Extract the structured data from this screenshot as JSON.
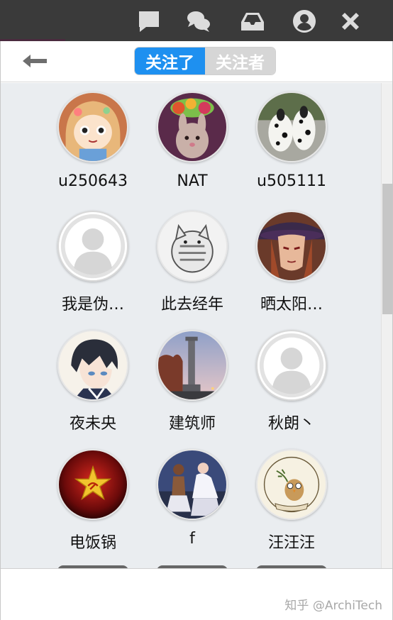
{
  "titlebar": {
    "icons": [
      "message-icon",
      "chat-bubbles-icon",
      "inbox-icon",
      "account-icon",
      "close-icon"
    ]
  },
  "navbar": {
    "back_icon": "back-arrow-icon",
    "tabs": [
      {
        "label": "关注了",
        "active": true
      },
      {
        "label": "关注者",
        "active": false
      }
    ]
  },
  "users": [
    {
      "name": "u250643",
      "avatar": "anime-girl"
    },
    {
      "name": "NAT",
      "avatar": "rabbit-fruit"
    },
    {
      "name": "u505111",
      "avatar": "dalmatians"
    },
    {
      "name": "我是伪…",
      "avatar": "default"
    },
    {
      "name": "此去经年",
      "avatar": "cat-cartoon"
    },
    {
      "name": "晒太阳…",
      "avatar": "cowboy-hat-woman"
    },
    {
      "name": "夜未央",
      "avatar": "anime-boy"
    },
    {
      "name": "建筑师",
      "avatar": "monument-dusk"
    },
    {
      "name": "秋朗丶",
      "avatar": "default"
    },
    {
      "name": "电饭锅",
      "avatar": "red-star"
    },
    {
      "name": "f",
      "avatar": "dancers"
    },
    {
      "name": "汪汪汪",
      "avatar": "owl-badge"
    }
  ],
  "footer": {
    "watermark": "知乎 @ArchiTech"
  },
  "colors": {
    "accent": "#1e90f0",
    "inactive_tab": "#d6d6d6",
    "titlebar": "#3a3a3a"
  }
}
